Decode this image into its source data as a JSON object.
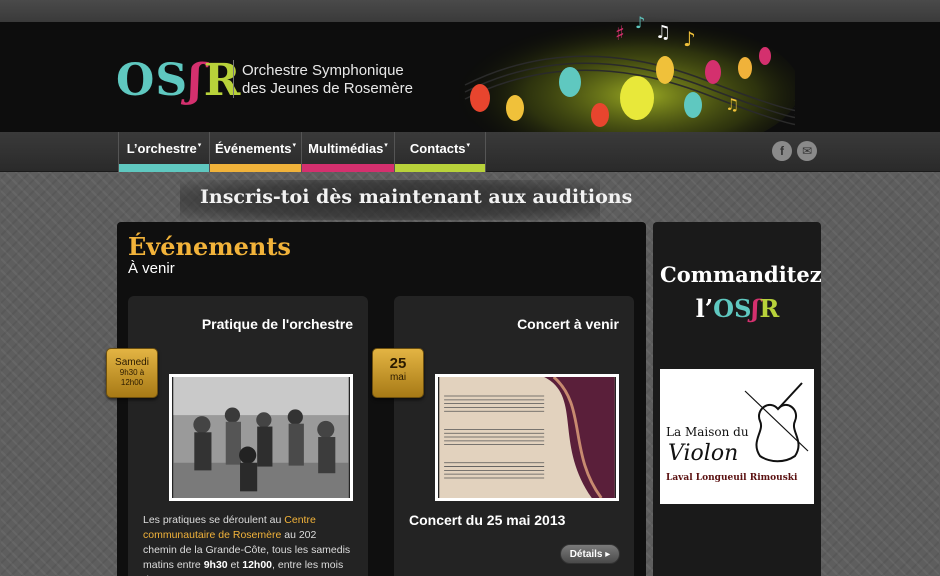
{
  "header": {
    "logo": {
      "p1": "OS",
      "p2": "R",
      "ornament": "ʃ"
    },
    "org_name_line1": "Orchestre Symphonique",
    "org_name_line2": "des Jeunes de Rosemère"
  },
  "nav": {
    "items": [
      {
        "label": "L’orchestre",
        "color": "#5fc8c0"
      },
      {
        "label": "Événements",
        "color": "#f0b23a"
      },
      {
        "label": "Multimédias",
        "color": "#d4306e"
      },
      {
        "label": "Contacts",
        "color": "#b8d23a"
      }
    ],
    "caret": "▾",
    "social": [
      {
        "icon": "facebook-icon",
        "glyph": "f"
      },
      {
        "icon": "email-icon",
        "glyph": "✉"
      }
    ]
  },
  "banner": {
    "text": "Inscris-toi dès maintenant aux auditions"
  },
  "events": {
    "title": "Événements",
    "subtitle": "À venir",
    "cards": [
      {
        "title": "Pratique de l'orchestre",
        "badge_line1": "Samedi",
        "badge_line2": "9h30 à",
        "badge_line3": "12h00",
        "text_before": "Les pratiques se déroulent au ",
        "text_link": "Centre communautaire de Rosemère",
        "text_mid": " au 202 chemin de la Grande-Côte, tous les samedis matins entre ",
        "time1": "9h30",
        "text_and": " et ",
        "time2": "12h00",
        "text_after": ", entre les mois de"
      },
      {
        "title": "Concert à venir",
        "badge_day": "25",
        "badge_month": "mai",
        "heading": "Concert du 25 mai 2013",
        "button": "Détails ▸"
      }
    ]
  },
  "sidebar": {
    "sponsor_title": "Commanditez",
    "sponsor_prefix": "l’",
    "sponsor_logo_p1": "OS",
    "sponsor_logo_p2": "R",
    "sponsor_logo_ornament": "ʃ",
    "sponsor": {
      "line1": "La Maison du",
      "line2": "Violon",
      "line3": "Laval Longueuil Rimouski"
    }
  },
  "colors": {
    "accent": "#f2b33a",
    "teal": "#5fc8c0",
    "magenta": "#d4306e",
    "lime": "#b8d23a"
  }
}
